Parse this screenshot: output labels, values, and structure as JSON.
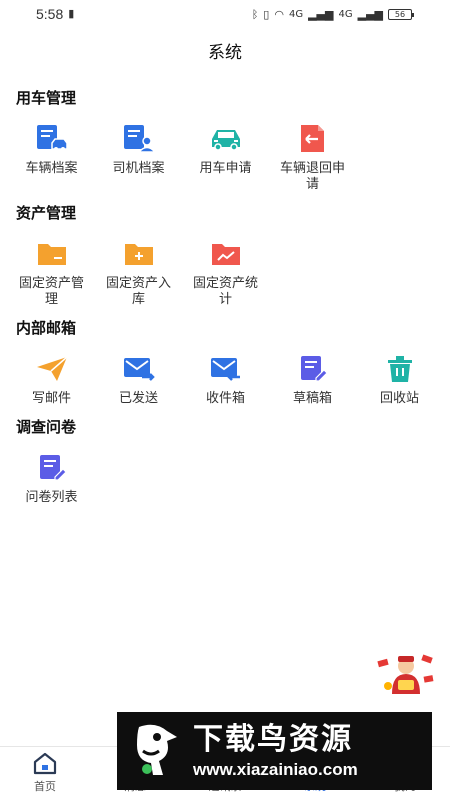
{
  "status_bar": {
    "time": "5:58",
    "network_1": "4G",
    "network_2": "4G",
    "battery": "56"
  },
  "header": {
    "title": "系统"
  },
  "sections": [
    {
      "title": "用车管理",
      "items": [
        {
          "label": "车辆档案",
          "icon": "vehicle-archive-icon",
          "color": "#2f72e3"
        },
        {
          "label": "司机档案",
          "icon": "driver-archive-icon",
          "color": "#2f72e3"
        },
        {
          "label": "用车申请",
          "icon": "car-request-icon",
          "color": "#1fb3a6"
        },
        {
          "label": "车辆退回申请",
          "icon": "vehicle-return-icon",
          "color": "#f0574d"
        }
      ]
    },
    {
      "title": "资产管理",
      "items": [
        {
          "label": "固定资产管理",
          "icon": "asset-folder-icon",
          "color": "#f4a12e"
        },
        {
          "label": "固定资产入库",
          "icon": "asset-add-folder-icon",
          "color": "#f4a12e"
        },
        {
          "label": "固定资产统计",
          "icon": "asset-stats-folder-icon",
          "color": "#f0574d"
        }
      ]
    },
    {
      "title": "内部邮箱",
      "items": [
        {
          "label": "写邮件",
          "icon": "paper-plane-icon",
          "color": "#f4a12e"
        },
        {
          "label": "已发送",
          "icon": "mail-sent-icon",
          "color": "#2f72e3"
        },
        {
          "label": "收件箱",
          "icon": "mail-inbox-icon",
          "color": "#2f72e3"
        },
        {
          "label": "草稿箱",
          "icon": "draft-edit-icon",
          "color": "#5b5ce6"
        },
        {
          "label": "回收站",
          "icon": "trash-icon",
          "color": "#1fb3a6"
        }
      ]
    },
    {
      "title": "调查问卷",
      "items": [
        {
          "label": "问卷列表",
          "icon": "survey-list-icon",
          "color": "#5b5ce6"
        }
      ]
    }
  ],
  "bottom_nav": {
    "home": "首页",
    "messages": "消息",
    "contacts": "通讯录",
    "system": "系统",
    "mine": "我的"
  },
  "watermark": {
    "title": "下载鸟资源",
    "url": "www.xiazainiao.com"
  }
}
